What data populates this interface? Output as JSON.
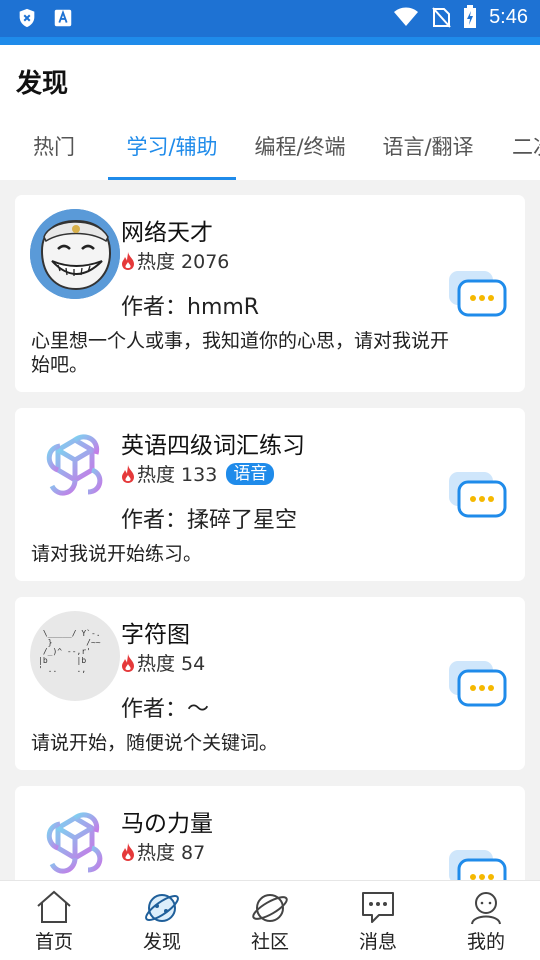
{
  "status_bar": {
    "time": "5:46"
  },
  "header": {
    "title": "发现"
  },
  "tabs": [
    {
      "label": "热门",
      "active": false
    },
    {
      "label": "学习/辅助",
      "active": true
    },
    {
      "label": "编程/终端",
      "active": false
    },
    {
      "label": "语言/翻译",
      "active": false
    },
    {
      "label": "二次",
      "active": false
    }
  ],
  "cards": [
    {
      "title": "网络天才",
      "heat": "热度 2076",
      "tag": "",
      "author": "作者：hmmR",
      "description": "心里想一个人或事，我知道你的心思，请对我说开始吧。",
      "avatar": "trollface"
    },
    {
      "title": "英语四级词汇练习",
      "heat": "热度 133",
      "tag": "语音",
      "author": "作者：揉碎了星空",
      "description": "请对我说开始练习。",
      "avatar": "openai-logo"
    },
    {
      "title": "字符图",
      "heat": "热度 54",
      "tag": "",
      "author": "作者：～",
      "description": "请说开始，随便说个关键词。",
      "avatar": "ascii-art"
    },
    {
      "title": "马の力量",
      "heat": "热度 87",
      "tag": "",
      "author": "",
      "description": "",
      "avatar": "openai-logo"
    }
  ],
  "ascii_art": " \\_____/ Y`-.\n  }       /~~\n /_)^ --,r'\n|b      |b\n' ..    .,",
  "bottom_nav": [
    {
      "label": "首页",
      "icon": "home-icon",
      "active": false
    },
    {
      "label": "发现",
      "icon": "planet-discover-icon",
      "active": true
    },
    {
      "label": "社区",
      "icon": "planet-icon",
      "active": false
    },
    {
      "label": "消息",
      "icon": "message-icon",
      "active": false
    },
    {
      "label": "我的",
      "icon": "profile-icon",
      "active": false
    }
  ],
  "colors": {
    "accent": "#1f8bea",
    "status_bar": "#1e72d3",
    "fire": "#e5393a"
  }
}
